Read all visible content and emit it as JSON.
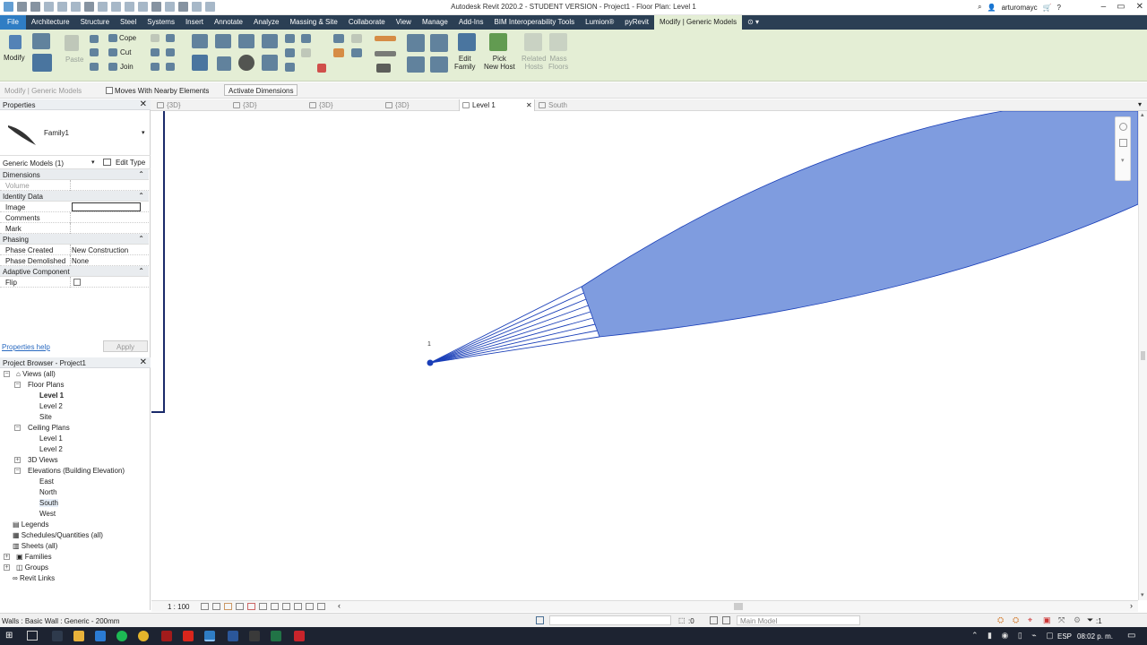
{
  "window": {
    "title": "Autodesk Revit 2020.2 - STUDENT VERSION - Project1 - Floor Plan: Level 1"
  },
  "user": {
    "name": "arturomayc"
  },
  "menu": {
    "tabs": [
      {
        "label": "File"
      },
      {
        "label": "Architecture"
      },
      {
        "label": "Structure"
      },
      {
        "label": "Steel"
      },
      {
        "label": "Systems"
      },
      {
        "label": "Insert"
      },
      {
        "label": "Annotate"
      },
      {
        "label": "Analyze"
      },
      {
        "label": "Massing & Site"
      },
      {
        "label": "Collaborate"
      },
      {
        "label": "View"
      },
      {
        "label": "Manage"
      },
      {
        "label": "Add-Ins"
      },
      {
        "label": "BIM Interoperability Tools"
      },
      {
        "label": "Lumion®"
      },
      {
        "label": "pyRevit"
      },
      {
        "label": "Modify | Generic Models"
      }
    ],
    "active": "Modify | Generic Models"
  },
  "ribbon": {
    "modify": "Modify",
    "paste": "Paste",
    "cope": "Cope",
    "cut": "Cut",
    "join": "Join",
    "edit_family": "Edit\nFamily",
    "pick_new_host": "Pick\nNew Host",
    "related_hosts": "Related\nHosts",
    "mass_floors": "Mass\nFloors"
  },
  "options_bar": {
    "context": "Modify | Generic Models",
    "moves_with": "Moves With Nearby Elements",
    "activate_dimensions": "Activate Dimensions"
  },
  "properties": {
    "title": "Properties",
    "type_name": "Family1",
    "selector": "Generic Models (1)",
    "edit_type": "Edit Type",
    "sections": {
      "dimensions": "Dimensions",
      "identity": "Identity Data",
      "phasing": "Phasing",
      "adaptive": "Adaptive Component"
    },
    "rows": {
      "volume": "Volume",
      "image": "Image",
      "comments": "Comments",
      "mark": "Mark",
      "phase_created": "Phase Created",
      "phase_created_val": "New Construction",
      "phase_demolished": "Phase Demolished",
      "phase_demolished_val": "None",
      "flip": "Flip"
    },
    "help": "Properties help",
    "apply": "Apply"
  },
  "browser": {
    "title": "Project Browser - Project1",
    "views_all": "Views (all)",
    "floor_plans": "Floor Plans",
    "fp_level1": "Level 1",
    "fp_level2": "Level 2",
    "fp_site": "Site",
    "ceiling_plans": "Ceiling Plans",
    "cp_level1": "Level 1",
    "cp_level2": "Level 2",
    "views_3d": "3D Views",
    "elevations": "Elevations (Building Elevation)",
    "el_east": "East",
    "el_north": "North",
    "el_south": "South",
    "el_west": "West",
    "legends": "Legends",
    "schedules": "Schedules/Quantities (all)",
    "sheets": "Sheets (all)",
    "families": "Families",
    "groups": "Groups",
    "revit_links": "Revit Links"
  },
  "view_tabs": [
    {
      "label": "{3D}"
    },
    {
      "label": "{3D}"
    },
    {
      "label": "{3D}"
    },
    {
      "label": "{3D}"
    },
    {
      "label": "Level 1"
    },
    {
      "label": "South"
    }
  ],
  "canvas": {
    "point_label": "1",
    "shape_color": "#7f9cdf",
    "line_color": "#1a3fb8"
  },
  "view_control": {
    "scale": "1 : 100"
  },
  "status": {
    "message": "Walls : Basic Wall : Generic - 200mm",
    "worksets": ":0",
    "model": "Main Model",
    "filter": ":1"
  },
  "taskbar": {
    "lang": "ESP",
    "time": "08:02 p. m."
  }
}
